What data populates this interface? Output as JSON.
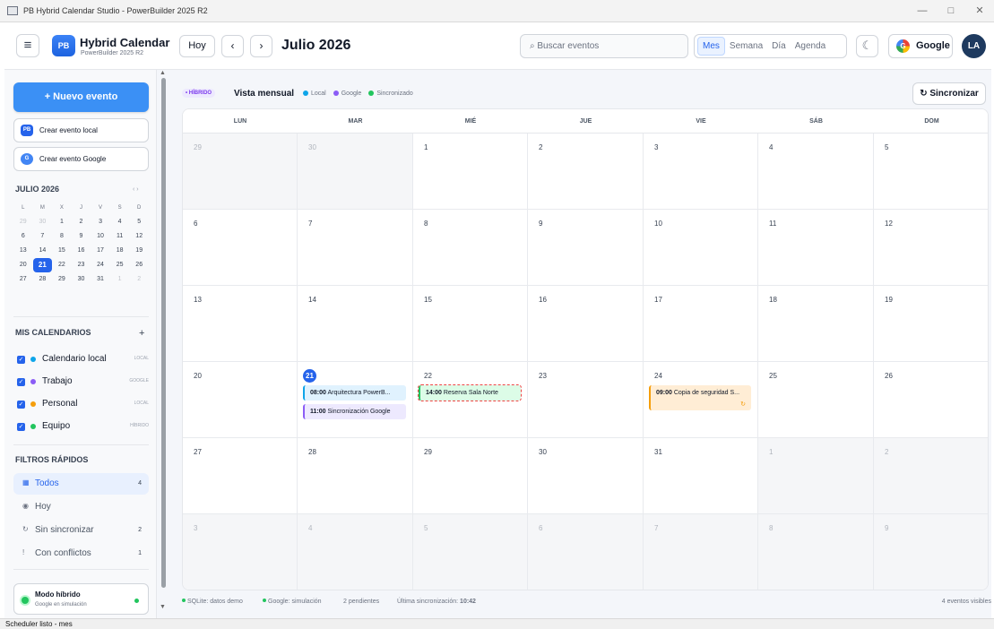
{
  "window": {
    "title": "PB Hybrid Calendar Studio - PowerBuilder 2025 R2",
    "minimize": "—",
    "maximize": "□",
    "close": "✕"
  },
  "header": {
    "menu_icon": "≡",
    "logo": "PB",
    "app_title": "Hybrid Calendar",
    "app_subtitle": "PowerBuilder 2025 R2",
    "today_label": "Hoy",
    "prev_label": "‹",
    "next_label": "›",
    "month_title": "Julio 2026",
    "search_placeholder": "⌕ Buscar eventos",
    "views": [
      "Mes",
      "Semana",
      "Día",
      "Agenda"
    ],
    "active_view": "Mes",
    "theme_icon": "☾",
    "google_label": "Google",
    "google_icon": "G",
    "avatar": "LA"
  },
  "sidebar": {
    "new_event": "+  Nuevo evento",
    "create_local": "Crear evento local",
    "create_local_icon": "PB",
    "create_google": "Crear evento Google",
    "create_google_icon": "G",
    "mini_title": "JULIO 2026",
    "mini_nav": "‹  ›",
    "weekdays": [
      "L",
      "M",
      "X",
      "J",
      "V",
      "S",
      "D"
    ],
    "mini_days": [
      [
        "29",
        "out"
      ],
      [
        "30",
        "out"
      ],
      [
        "1",
        ""
      ],
      [
        "2",
        ""
      ],
      [
        "3",
        ""
      ],
      [
        "4",
        ""
      ],
      [
        "5",
        ""
      ],
      [
        "6",
        ""
      ],
      [
        "7",
        ""
      ],
      [
        "8",
        ""
      ],
      [
        "9",
        ""
      ],
      [
        "10",
        ""
      ],
      [
        "11",
        ""
      ],
      [
        "12",
        ""
      ],
      [
        "13",
        ""
      ],
      [
        "14",
        ""
      ],
      [
        "15",
        ""
      ],
      [
        "16",
        ""
      ],
      [
        "17",
        ""
      ],
      [
        "18",
        ""
      ],
      [
        "19",
        ""
      ],
      [
        "20",
        ""
      ],
      [
        "21",
        "today"
      ],
      [
        "22",
        ""
      ],
      [
        "23",
        ""
      ],
      [
        "24",
        ""
      ],
      [
        "25",
        ""
      ],
      [
        "26",
        ""
      ],
      [
        "27",
        ""
      ],
      [
        "28",
        ""
      ],
      [
        "29",
        ""
      ],
      [
        "30",
        ""
      ],
      [
        "31",
        ""
      ],
      [
        "1",
        "out"
      ],
      [
        "2",
        "out"
      ]
    ],
    "calendars_title": "MIS CALENDARIOS",
    "calendars_add": "+",
    "calendars": [
      {
        "name": "Calendario local",
        "tag": "LOCAL",
        "color": "#0ea5e9"
      },
      {
        "name": "Trabajo",
        "tag": "GOOGLE",
        "color": "#8b5cf6"
      },
      {
        "name": "Personal",
        "tag": "LOCAL",
        "color": "#f59e0b"
      },
      {
        "name": "Equipo",
        "tag": "HÍBRIDO",
        "color": "#22c55e"
      }
    ],
    "filters_title": "FILTROS RÁPIDOS",
    "filters": [
      {
        "icon": "▦",
        "label": "Todos",
        "count": "4"
      },
      {
        "icon": "◉",
        "label": "Hoy",
        "count": ""
      },
      {
        "icon": "↻",
        "label": "Sin sincronizar",
        "count": "2"
      },
      {
        "icon": "!",
        "label": "Con conflictos",
        "count": "1"
      }
    ],
    "hybrid_title": "Modo híbrido",
    "hybrid_sub": "Google en simulación"
  },
  "main": {
    "badge": "• HÍBRIDO",
    "view_title": "Vista mensual",
    "legend": [
      {
        "label": "Local",
        "color": "#0ea5e9"
      },
      {
        "label": "Google",
        "color": "#8b5cf6"
      },
      {
        "label": "Sincronizado",
        "color": "#22c55e"
      }
    ],
    "sync_button": "↻ Sincronizar",
    "weekdays": [
      "LUN",
      "MAR",
      "MIÉ",
      "JUE",
      "VIE",
      "SÁB",
      "DOM"
    ],
    "weeks": [
      [
        [
          "29",
          "out"
        ],
        [
          "30",
          "out"
        ],
        [
          "1",
          ""
        ],
        [
          "2",
          ""
        ],
        [
          "3",
          ""
        ],
        [
          "4",
          ""
        ],
        [
          "5",
          ""
        ]
      ],
      [
        [
          "6",
          ""
        ],
        [
          "7",
          ""
        ],
        [
          "8",
          ""
        ],
        [
          "9",
          ""
        ],
        [
          "10",
          ""
        ],
        [
          "11",
          ""
        ],
        [
          "12",
          ""
        ]
      ],
      [
        [
          "13",
          ""
        ],
        [
          "14",
          ""
        ],
        [
          "15",
          ""
        ],
        [
          "16",
          ""
        ],
        [
          "17",
          ""
        ],
        [
          "18",
          ""
        ],
        [
          "19",
          ""
        ]
      ],
      [
        [
          "20",
          ""
        ],
        [
          "21",
          "today"
        ],
        [
          "22",
          ""
        ],
        [
          "23",
          ""
        ],
        [
          "24",
          ""
        ],
        [
          "25",
          ""
        ],
        [
          "26",
          ""
        ]
      ],
      [
        [
          "27",
          ""
        ],
        [
          "28",
          ""
        ],
        [
          "29",
          ""
        ],
        [
          "30",
          ""
        ],
        [
          "31",
          ""
        ],
        [
          "1",
          "out"
        ],
        [
          "2",
          "out"
        ]
      ],
      [
        [
          "3",
          "out"
        ],
        [
          "4",
          "out"
        ],
        [
          "5",
          "out"
        ],
        [
          "6",
          "out"
        ],
        [
          "7",
          "out"
        ],
        [
          "8",
          "out"
        ],
        [
          "9",
          "out"
        ]
      ]
    ],
    "events": [
      {
        "week": 3,
        "day": 1,
        "slot": 0,
        "time": "08:00",
        "title": "Arquitectura PowerB...",
        "style": "ev-blue"
      },
      {
        "week": 3,
        "day": 1,
        "slot": 1,
        "time": "11:00",
        "title": "Sincronización Google",
        "style": "ev-purple"
      },
      {
        "week": 3,
        "day": 2,
        "slot": 0,
        "time": "14:00",
        "title": "Reserva Sala Norte",
        "style": "ev-green"
      },
      {
        "week": 3,
        "day": 4,
        "slot": 0,
        "time": "09:00",
        "title": "Copia de seguridad S...",
        "style": "ev-orange",
        "sync_icon": "↻"
      }
    ]
  },
  "status": {
    "sqlite": "SQLite: datos demo",
    "google": "Google: simulación",
    "pending": "2 pendientes",
    "last_sync_label": "Última sincronización:",
    "last_sync_time": "10:42",
    "visible": "4 eventos visibles"
  },
  "statusbar": "Scheduler listo - mes"
}
